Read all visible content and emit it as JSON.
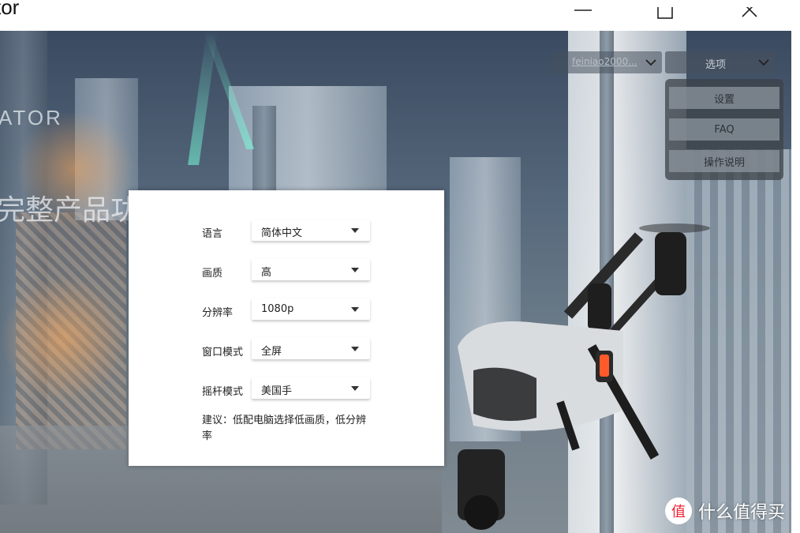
{
  "window": {
    "title": "tor",
    "controls": [
      "minimize-icon",
      "maximize-icon",
      "close-icon"
    ]
  },
  "background": {
    "brand_text": "ATOR",
    "tagline": "完整产品功能。"
  },
  "top_controls": {
    "user_dropdown": "feiniao2000...",
    "options_dropdown": "选项",
    "menu_items": [
      "设置",
      "FAQ",
      "操作说明"
    ]
  },
  "settings_dialog": {
    "rows": [
      {
        "label": "语言",
        "value": "简体中文"
      },
      {
        "label": "画质",
        "value": "高"
      },
      {
        "label": "分辨率",
        "value": "1080p"
      },
      {
        "label": "窗口模式",
        "value": "全屏"
      },
      {
        "label": "摇杆模式",
        "value": "美国手"
      }
    ],
    "hint": "建议：低配电脑选择低画质，低分辨率"
  },
  "watermark": {
    "text": "什么值得买",
    "logo_glyph": "值"
  },
  "colors": {
    "dialog_bg": "#ffffff",
    "menu_item_bg": "#8c969e",
    "accent_drone_light": "#ff5a2a"
  }
}
